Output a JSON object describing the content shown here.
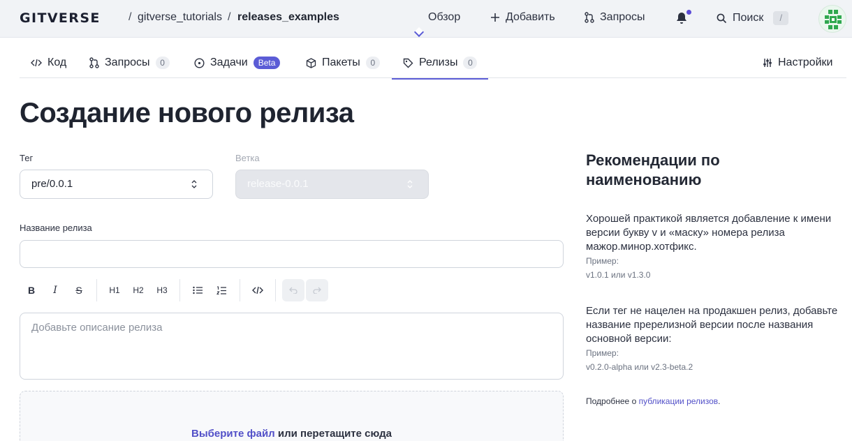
{
  "header": {
    "logo": "GITVERSE",
    "breadcrumb": {
      "owner": "gitverse_tutorials",
      "repo": "releases_examples",
      "separator": "/"
    },
    "nav": {
      "overview": "Обзор",
      "add": "Добавить",
      "requests": "Запросы",
      "search": "Поиск",
      "search_shortcut": "/"
    }
  },
  "tabs": [
    {
      "label": "Код",
      "icon": "code-icon"
    },
    {
      "label": "Запросы",
      "count": "0",
      "icon": "pull-request-icon"
    },
    {
      "label": "Задачи",
      "badge": "Beta",
      "icon": "issue-icon"
    },
    {
      "label": "Пакеты",
      "count": "0",
      "icon": "package-icon"
    },
    {
      "label": "Релизы",
      "count": "0",
      "icon": "tag-icon",
      "active": true
    }
  ],
  "settings_label": "Настройки",
  "page_title": "Создание нового релиза",
  "form": {
    "tag_label": "Тег",
    "tag_value": "pre/0.0.1",
    "branch_label": "Ветка",
    "branch_value": "release-0.0.1",
    "release_name_label": "Название релиза",
    "release_name_value": "",
    "toolbar": {
      "bold": "B",
      "italic": "I",
      "strike": "S",
      "h1": "H1",
      "h2": "H2",
      "h3": "H3"
    },
    "description_placeholder": "Добавьте описание релиза",
    "dropzone_link": "Выберите файл",
    "dropzone_text": "или перетащите сюда"
  },
  "sidebar": {
    "title": "Рекомендации по наименованию",
    "p1": "Хорошей практикой является добавление к имени версии букву v и «маску» номера релиза мажор.минор.хотфикс.",
    "example_label_1": "Пример:",
    "example_1": "v1.0.1 или v1.3.0",
    "p2": "Если тег не нацелен на продакшен релиз, добавьте название пререлизной версии после названия основной версии:",
    "example_label_2": "Пример:",
    "example_2": "v0.2.0-alpha или v2.3-beta.2",
    "more_prefix": "Подробнее о",
    "more_link": "публикации релизов",
    "more_suffix": "."
  },
  "colors": {
    "accent": "#5b5cd6",
    "link": "#5250c8",
    "topbar": "#f1f3f6"
  }
}
